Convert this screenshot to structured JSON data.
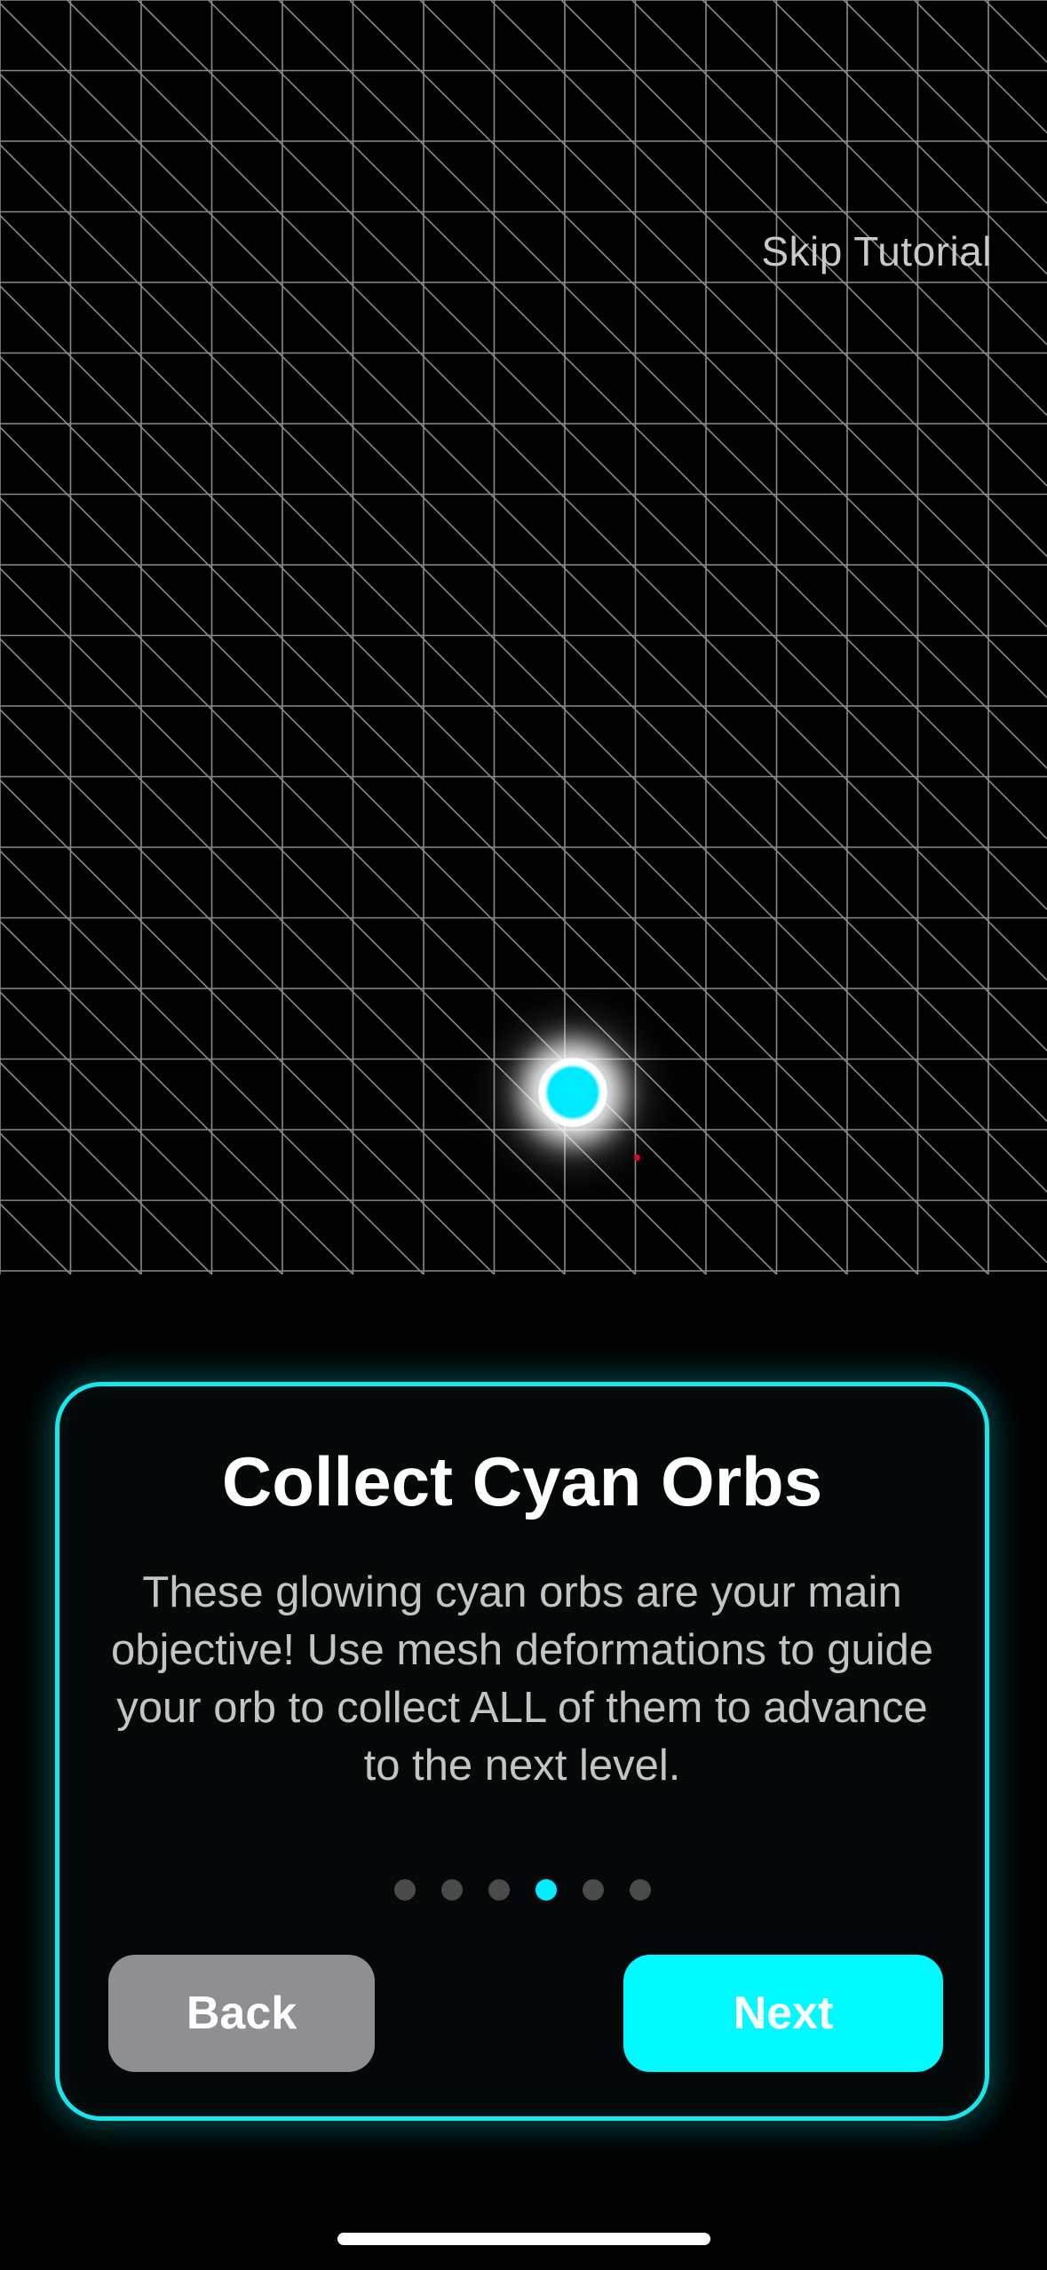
{
  "header": {
    "skip_label": "Skip Tutorial"
  },
  "tutorial": {
    "title": "Collect Cyan Orbs",
    "body": "These glowing cyan orbs are your main objective! Use mesh deformations to guide your orb to collect ALL of them to advance to the next level.",
    "step_count": 6,
    "current_step": 4
  },
  "buttons": {
    "back_label": "Back",
    "next_label": "Next"
  },
  "colors": {
    "accent": "#00faff",
    "card_border": "#18e6ea",
    "back_button": "#8e8e93",
    "mesh_line": "#8a8a8a",
    "inactive_dot": "#4a4a4a",
    "hazard_dot": "#e4002b"
  }
}
